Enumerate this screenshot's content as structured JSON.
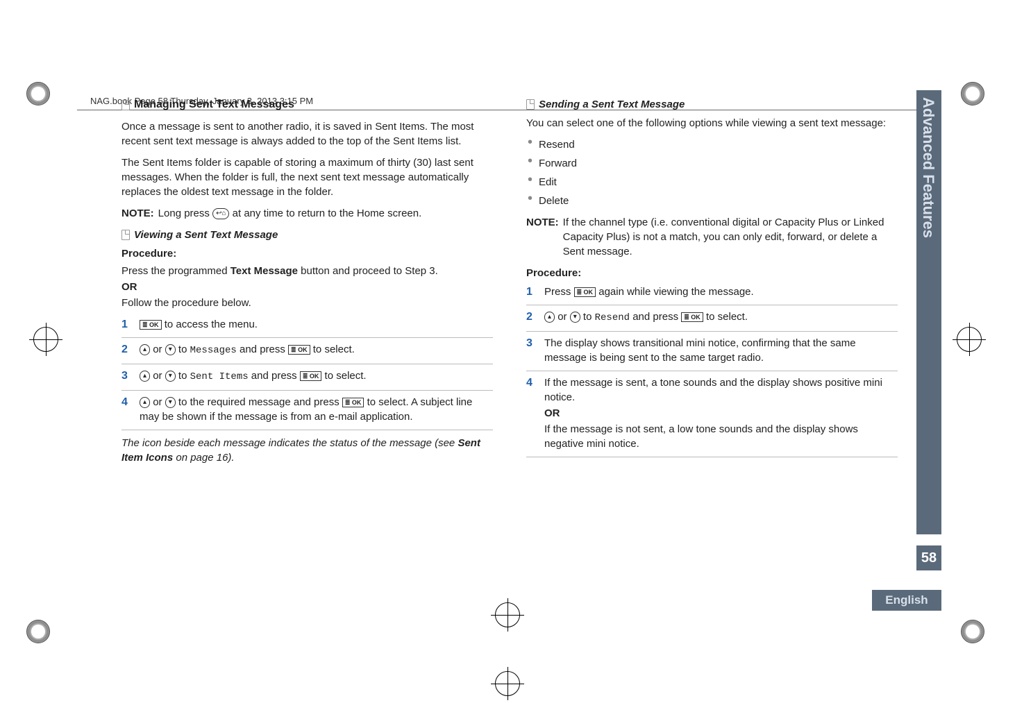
{
  "header": {
    "running_head": "NAG.book  Page 58  Thursday, January 3, 2013  3:15 PM"
  },
  "side_tab": {
    "label": "Advanced Features"
  },
  "page_number": "58",
  "language": "English",
  "left": {
    "h1": "Managing Sent Text Messages",
    "para1": "Once a message is sent to another radio, it is saved in Sent Items. The most recent sent text message is always added to the top of the Sent Items list.",
    "para2": "The Sent Items folder is capable of storing a maximum of thirty (30) last sent messages. When the folder is full, the next sent text message automatically replaces the oldest text message in the folder.",
    "note_label": "NOTE:",
    "note_body_a": "Long press ",
    "note_body_b": " at any time to return to the Home screen.",
    "h2": "Viewing a Sent Text Message",
    "procedure_label": "Procedure:",
    "proc_intro_a": "Press the programmed ",
    "proc_intro_bold": "Text Message",
    "proc_intro_b": " button and proceed to Step 3.",
    "or_label": "OR",
    "proc_follow": "Follow the procedure below.",
    "steps": {
      "s1": " to access the menu.",
      "s2_or": " or ",
      "s2_to": " to ",
      "s2_code": "Messages",
      "s2_press": " and press ",
      "s2_end": " to select.",
      "s3_code": "Sent Items",
      "s4_mid": " to the required message and press ",
      "s4_end": " to select. A subject line may be shown if the message is from an e-mail application."
    },
    "footnote_a": "The icon beside each message indicates the status of the message (see ",
    "footnote_bold": "Sent Item Icons",
    "footnote_b": " on page 16)."
  },
  "right": {
    "h2": "Sending a Sent Text Message",
    "para1": "You can select one of the following options while viewing a sent text message:",
    "bullets": {
      "b1": "Resend",
      "b2": "Forward",
      "b3": "Edit",
      "b4": "Delete"
    },
    "note_label": "NOTE:",
    "note_body": "If the channel type (i.e. conventional digital or Capacity Plus or Linked Capacity Plus) is not a match, you can only edit, forward, or delete a Sent message.",
    "procedure_label": "Procedure:",
    "steps": {
      "s1_a": "Press ",
      "s1_b": " again while viewing the message.",
      "s2_or": " or ",
      "s2_to": " to ",
      "s2_code": "Resend",
      "s2_press": " and press ",
      "s2_end": " to select.",
      "s3": "The display shows transitional mini notice, confirming that the same message is being sent to the same target radio.",
      "s4_a": "If the message is sent, a tone sounds and the display shows positive mini notice.",
      "s4_or": "OR",
      "s4_b": "If the message is not sent, a low tone sounds and the display shows negative mini notice."
    }
  },
  "icons": {
    "home": "↩⌂",
    "ok": "≣ OK",
    "up": "▴",
    "down": "▾"
  }
}
